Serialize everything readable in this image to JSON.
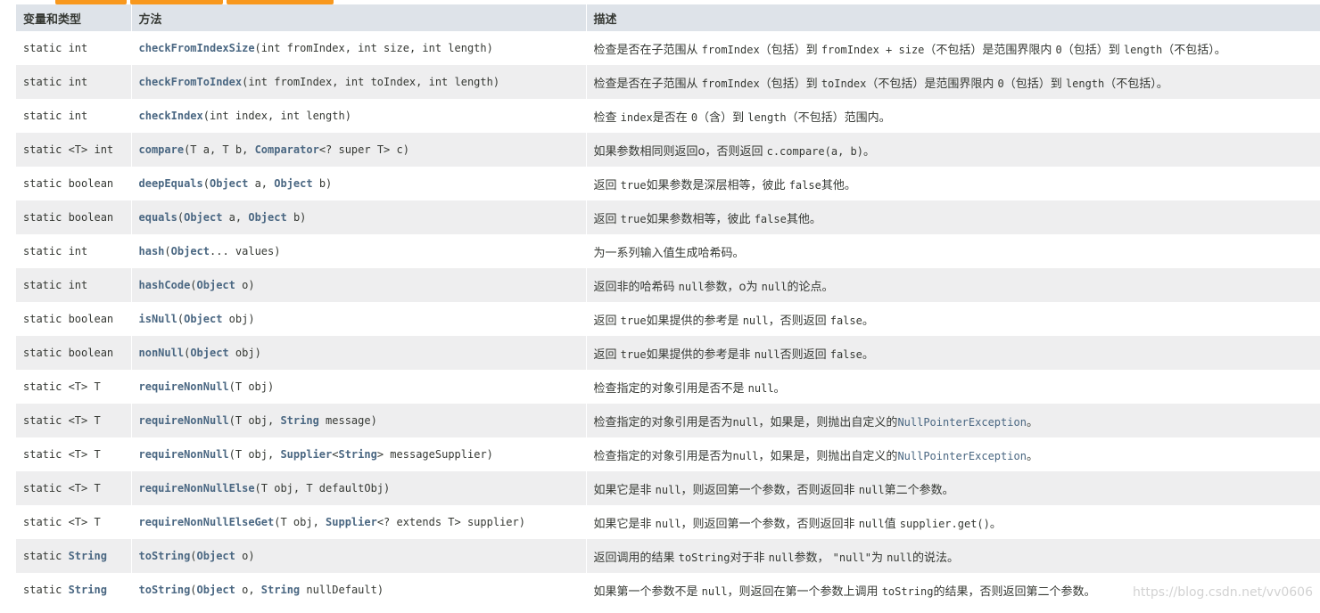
{
  "header": {
    "col_type": "变量和类型",
    "col_method": "方法",
    "col_desc": "描述"
  },
  "rows": [
    {
      "type": "static int",
      "name": "checkFromIndexSize",
      "params": "(int fromIndex, int size, int length)",
      "desc": [
        "检查是否在子范围从 ",
        "fromIndex",
        "（包括）到 ",
        "fromIndex + size",
        "（不包括）是范围界限内 ",
        "0",
        "（包括）到 ",
        "length",
        "（不包括）。"
      ]
    },
    {
      "type": "static int",
      "name": "checkFromToIndex",
      "params": "(int fromIndex, int toIndex, int length)",
      "desc": [
        "检查是否在子范围从 ",
        "fromIndex",
        "（包括）到 ",
        "toIndex",
        "（不包括）是范围界限内 ",
        "0",
        "（包括）到 ",
        "length",
        "（不包括）。"
      ]
    },
    {
      "type": "static int",
      "name": "checkIndex",
      "params": "(int index, int length)",
      "desc": [
        "检查 ",
        "index",
        "是否在 ",
        "0",
        "（含）到 ",
        "length",
        "（不包括）范围内。"
      ]
    },
    {
      "type": "static <T> int",
      "name": "compare",
      "params": "(T a, T b, Comparator<? super T> c)",
      "desc": [
        "如果参数相同则返回o，否则返回 ",
        "c.compare(a, b)",
        "。"
      ]
    },
    {
      "type": "static boolean",
      "name": "deepEquals",
      "params": "(Object a, Object b)",
      "desc": [
        "返回 ",
        "true",
        "如果参数是深层相等，彼此 ",
        "false",
        "其他。"
      ]
    },
    {
      "type": "static boolean",
      "name": "equals",
      "params": "(Object a, Object b)",
      "desc": [
        "返回 ",
        "true",
        "如果参数相等，彼此 ",
        "false",
        "其他。"
      ]
    },
    {
      "type": "static int",
      "name": "hash",
      "params": "(Object... values)",
      "desc": [
        "为一系列输入值生成哈希码。"
      ]
    },
    {
      "type": "static int",
      "name": "hashCode",
      "params": "(Object o)",
      "desc": [
        "返回非的哈希码 ",
        "null",
        "参数，o为 ",
        "null",
        "的论点。"
      ]
    },
    {
      "type": "static boolean",
      "name": "isNull",
      "params": "(Object obj)",
      "desc": [
        "返回 ",
        "true",
        "如果提供的参考是 ",
        "null",
        "，否则返回 ",
        "false",
        "。"
      ]
    },
    {
      "type": "static boolean",
      "name": "nonNull",
      "params": "(Object obj)",
      "desc": [
        "返回 ",
        "true",
        "如果提供的参考是非 ",
        "null",
        "否则返回 ",
        "false",
        "。"
      ]
    },
    {
      "type": "static <T> T",
      "name": "requireNonNull",
      "params": "(T obj)",
      "desc": [
        "检查指定的对象引用是否不是 ",
        "null",
        "。"
      ]
    },
    {
      "type": "static <T> T",
      "name": "requireNonNull",
      "params": "(T obj, String message)",
      "desc": [
        "检查指定的对象引用是否为",
        "null",
        "，如果是，则抛出自定义的",
        "NullPointerException",
        "。"
      ]
    },
    {
      "type": "static <T> T",
      "name": "requireNonNull",
      "params": "(T obj, Supplier<String> messageSupplier)",
      "desc": [
        "检查指定的对象引用是否为",
        "null",
        "，如果是，则抛出自定义的",
        "NullPointerException",
        "。"
      ]
    },
    {
      "type": "static <T> T",
      "name": "requireNonNullElse",
      "params": "(T obj, T defaultObj)",
      "desc": [
        "如果它是非 ",
        "null",
        "，则返回第一个参数，否则返回非 ",
        "null",
        "第二个参数。"
      ]
    },
    {
      "type": "static <T> T",
      "name": "requireNonNullElseGet",
      "params": "(T obj, Supplier<? extends T> supplier)",
      "desc": [
        "如果它是非 ",
        "null",
        "，则返回第一个参数，否则返回非 ",
        "null",
        "值 ",
        "supplier.get()",
        "。"
      ]
    },
    {
      "type": "static String",
      "name": "toString",
      "params": "(Object o)",
      "desc": [
        "返回调用的结果 ",
        "toString",
        "对于非 ",
        "null",
        "参数， ",
        "\"null\"",
        "为 ",
        "null",
        "的说法。"
      ]
    },
    {
      "type": "static String",
      "name": "toString",
      "params": "(Object o, String nullDefault)",
      "desc": [
        "如果第一个参数不是 ",
        "null",
        "，则返回在第一个参数上调用 ",
        "toString",
        "的结果，否则返回第二个参数。"
      ]
    }
  ],
  "link_types": [
    "Comparator",
    "Object",
    "String",
    "Supplier",
    "NullPointerException"
  ],
  "watermark": "https://blog.csdn.net/vv0606",
  "colors": {
    "header_bg": "#dee3e9",
    "stripe_bg": "#eeeeef",
    "link": "#4a6782",
    "text": "#353833",
    "tab": "#f8981d"
  }
}
